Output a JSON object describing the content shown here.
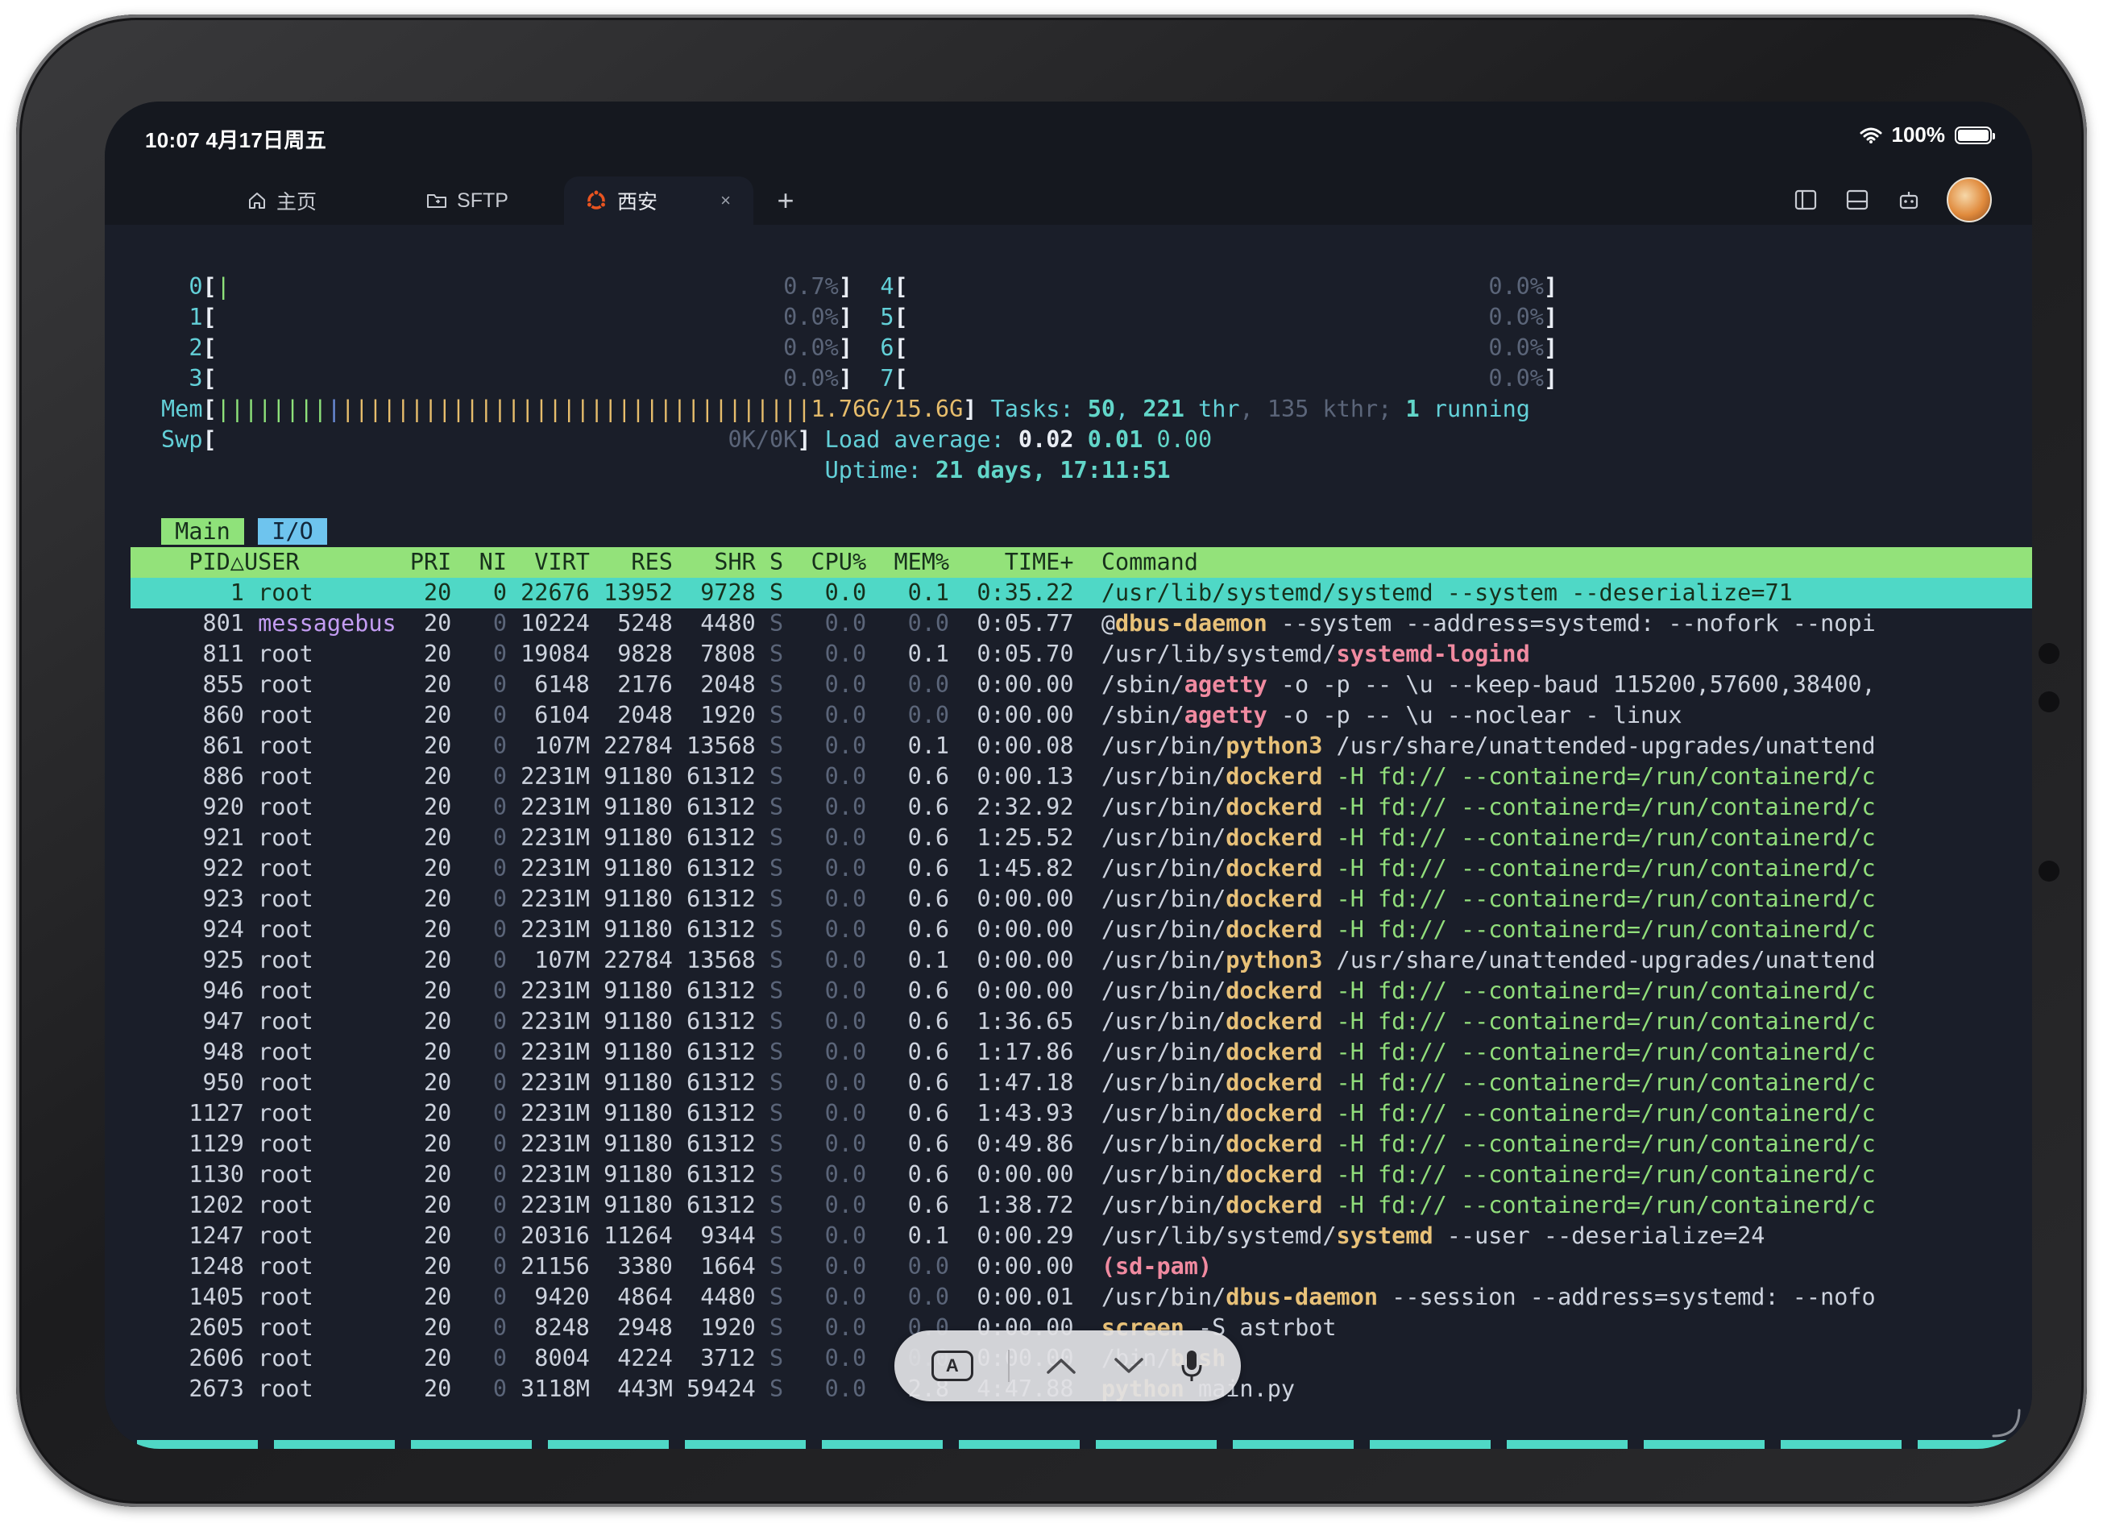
{
  "status": {
    "time": "10:07  4月17日周五",
    "battery": "100%"
  },
  "tabs": [
    {
      "label": "主页",
      "icon": "home-icon"
    },
    {
      "label": "SFTP",
      "icon": "folder-icon"
    },
    {
      "label": "西安",
      "icon": "ubuntu-icon",
      "close": "×"
    }
  ],
  "tab_add": "+",
  "colors": {
    "terminal_bg": "#1a1e29",
    "header_green": "#93e27a",
    "selected_teal": "#4fd8c6",
    "accent_yellow": "#e8c178"
  },
  "meters": {
    "cpus": [
      {
        "id": "0",
        "value": "0.7%"
      },
      {
        "id": "1",
        "value": "0.0%"
      },
      {
        "id": "2",
        "value": "0.0%"
      },
      {
        "id": "3",
        "value": "0.0%"
      },
      {
        "id": "4",
        "value": "0.0%"
      },
      {
        "id": "5",
        "value": "0.0%"
      },
      {
        "id": "6",
        "value": "0.0%"
      },
      {
        "id": "7",
        "value": "0.0%"
      }
    ],
    "mem_label": "Mem",
    "mem_value": "1.76G/15.6G",
    "swp_label": "Swp",
    "swp_value": "0K/0K",
    "tasks_label": "Tasks:",
    "tasks_count": "50",
    "threads": "221",
    "thr_label": "thr",
    "kthreads": "135",
    "kthr_label": "kthr;",
    "running": "1",
    "running_label": "running",
    "load_label": "Load average:",
    "load1": "0.02",
    "load5": "0.01",
    "load15": "0.00",
    "uptime_label": "Uptime:",
    "uptime": "21 days, 17:11:51"
  },
  "view_tabs": [
    "Main",
    "I/O"
  ],
  "columns": [
    "PID△",
    "USER",
    "PRI",
    "NI",
    "VIRT",
    "RES",
    "SHR",
    "S",
    "CPU%",
    "MEM%",
    "TIME+",
    "Command"
  ],
  "processes": [
    {
      "pid": "1",
      "user": "root",
      "pri": "20",
      "ni": "0",
      "virt": "22676",
      "res": "13952",
      "shr": "9728",
      "s": "S",
      "cpu": "0.0",
      "mem": "0.1",
      "time": "0:35.22",
      "cmd_pre": "/usr/lib/systemd/systemd",
      "cmd_name": "",
      "cmd_args": " --system --deserialize=71"
    },
    {
      "pid": "801",
      "user": "messagebus",
      "pri": "20",
      "ni": "0",
      "virt": "10224",
      "res": "5248",
      "shr": "4480",
      "s": "S",
      "cpu": "0.0",
      "mem": "0.0",
      "time": "0:05.77",
      "cmd_pre": "@",
      "cmd_name": "dbus-daemon",
      "cmd_args": " --system --address=systemd: --nofork --nopi"
    },
    {
      "pid": "811",
      "user": "root",
      "pri": "20",
      "ni": "0",
      "virt": "19084",
      "res": "9828",
      "shr": "7808",
      "s": "S",
      "cpu": "0.0",
      "mem": "0.1",
      "time": "0:05.70",
      "cmd_pre": "/usr/lib/systemd/",
      "cmd_name": "systemd-logind",
      "cmd_args": ""
    },
    {
      "pid": "855",
      "user": "root",
      "pri": "20",
      "ni": "0",
      "virt": "6148",
      "res": "2176",
      "shr": "2048",
      "s": "S",
      "cpu": "0.0",
      "mem": "0.0",
      "time": "0:00.00",
      "cmd_pre": "/sbin/",
      "cmd_name": "agetty",
      "cmd_args": " -o -p -- \\u --keep-baud 115200,57600,38400,"
    },
    {
      "pid": "860",
      "user": "root",
      "pri": "20",
      "ni": "0",
      "virt": "6104",
      "res": "2048",
      "shr": "1920",
      "s": "S",
      "cpu": "0.0",
      "mem": "0.0",
      "time": "0:00.00",
      "cmd_pre": "/sbin/",
      "cmd_name": "agetty",
      "cmd_args": " -o -p -- \\u --noclear - linux"
    },
    {
      "pid": "861",
      "user": "root",
      "pri": "20",
      "ni": "0",
      "virt": "107M",
      "res": "22784",
      "shr": "13568",
      "s": "S",
      "cpu": "0.0",
      "mem": "0.1",
      "time": "0:00.08",
      "cmd_pre": "/usr/bin/",
      "cmd_name": "python3",
      "cmd_args": " /usr/share/unattended-upgrades/unattend"
    },
    {
      "pid": "886",
      "user": "root",
      "pri": "20",
      "ni": "0",
      "virt": "2231M",
      "res": "91180",
      "shr": "61312",
      "s": "S",
      "cpu": "0.0",
      "mem": "0.6",
      "time": "0:00.13",
      "cmd_pre": "/usr/bin/",
      "cmd_name": "dockerd",
      "cmd_args": " -H fd:// --containerd=/run/containerd/c"
    },
    {
      "pid": "920",
      "user": "root",
      "pri": "20",
      "ni": "0",
      "virt": "2231M",
      "res": "91180",
      "shr": "61312",
      "s": "S",
      "cpu": "0.0",
      "mem": "0.6",
      "time": "2:32.92",
      "cmd_pre": "/usr/bin/",
      "cmd_name": "dockerd",
      "cmd_args": " -H fd:// --containerd=/run/containerd/c"
    },
    {
      "pid": "921",
      "user": "root",
      "pri": "20",
      "ni": "0",
      "virt": "2231M",
      "res": "91180",
      "shr": "61312",
      "s": "S",
      "cpu": "0.0",
      "mem": "0.6",
      "time": "1:25.52",
      "cmd_pre": "/usr/bin/",
      "cmd_name": "dockerd",
      "cmd_args": " -H fd:// --containerd=/run/containerd/c"
    },
    {
      "pid": "922",
      "user": "root",
      "pri": "20",
      "ni": "0",
      "virt": "2231M",
      "res": "91180",
      "shr": "61312",
      "s": "S",
      "cpu": "0.0",
      "mem": "0.6",
      "time": "1:45.82",
      "cmd_pre": "/usr/bin/",
      "cmd_name": "dockerd",
      "cmd_args": " -H fd:// --containerd=/run/containerd/c"
    },
    {
      "pid": "923",
      "user": "root",
      "pri": "20",
      "ni": "0",
      "virt": "2231M",
      "res": "91180",
      "shr": "61312",
      "s": "S",
      "cpu": "0.0",
      "mem": "0.6",
      "time": "0:00.00",
      "cmd_pre": "/usr/bin/",
      "cmd_name": "dockerd",
      "cmd_args": " -H fd:// --containerd=/run/containerd/c"
    },
    {
      "pid": "924",
      "user": "root",
      "pri": "20",
      "ni": "0",
      "virt": "2231M",
      "res": "91180",
      "shr": "61312",
      "s": "S",
      "cpu": "0.0",
      "mem": "0.6",
      "time": "0:00.00",
      "cmd_pre": "/usr/bin/",
      "cmd_name": "dockerd",
      "cmd_args": " -H fd:// --containerd=/run/containerd/c"
    },
    {
      "pid": "925",
      "user": "root",
      "pri": "20",
      "ni": "0",
      "virt": "107M",
      "res": "22784",
      "shr": "13568",
      "s": "S",
      "cpu": "0.0",
      "mem": "0.1",
      "time": "0:00.00",
      "cmd_pre": "/usr/bin/",
      "cmd_name": "python3",
      "cmd_args": " /usr/share/unattended-upgrades/unattend"
    },
    {
      "pid": "946",
      "user": "root",
      "pri": "20",
      "ni": "0",
      "virt": "2231M",
      "res": "91180",
      "shr": "61312",
      "s": "S",
      "cpu": "0.0",
      "mem": "0.6",
      "time": "0:00.00",
      "cmd_pre": "/usr/bin/",
      "cmd_name": "dockerd",
      "cmd_args": " -H fd:// --containerd=/run/containerd/c"
    },
    {
      "pid": "947",
      "user": "root",
      "pri": "20",
      "ni": "0",
      "virt": "2231M",
      "res": "91180",
      "shr": "61312",
      "s": "S",
      "cpu": "0.0",
      "mem": "0.6",
      "time": "1:36.65",
      "cmd_pre": "/usr/bin/",
      "cmd_name": "dockerd",
      "cmd_args": " -H fd:// --containerd=/run/containerd/c"
    },
    {
      "pid": "948",
      "user": "root",
      "pri": "20",
      "ni": "0",
      "virt": "2231M",
      "res": "91180",
      "shr": "61312",
      "s": "S",
      "cpu": "0.0",
      "mem": "0.6",
      "time": "1:17.86",
      "cmd_pre": "/usr/bin/",
      "cmd_name": "dockerd",
      "cmd_args": " -H fd:// --containerd=/run/containerd/c"
    },
    {
      "pid": "950",
      "user": "root",
      "pri": "20",
      "ni": "0",
      "virt": "2231M",
      "res": "91180",
      "shr": "61312",
      "s": "S",
      "cpu": "0.0",
      "mem": "0.6",
      "time": "1:47.18",
      "cmd_pre": "/usr/bin/",
      "cmd_name": "dockerd",
      "cmd_args": " -H fd:// --containerd=/run/containerd/c"
    },
    {
      "pid": "1127",
      "user": "root",
      "pri": "20",
      "ni": "0",
      "virt": "2231M",
      "res": "91180",
      "shr": "61312",
      "s": "S",
      "cpu": "0.0",
      "mem": "0.6",
      "time": "1:43.93",
      "cmd_pre": "/usr/bin/",
      "cmd_name": "dockerd",
      "cmd_args": " -H fd:// --containerd=/run/containerd/c"
    },
    {
      "pid": "1129",
      "user": "root",
      "pri": "20",
      "ni": "0",
      "virt": "2231M",
      "res": "91180",
      "shr": "61312",
      "s": "S",
      "cpu": "0.0",
      "mem": "0.6",
      "time": "0:49.86",
      "cmd_pre": "/usr/bin/",
      "cmd_name": "dockerd",
      "cmd_args": " -H fd:// --containerd=/run/containerd/c"
    },
    {
      "pid": "1130",
      "user": "root",
      "pri": "20",
      "ni": "0",
      "virt": "2231M",
      "res": "91180",
      "shr": "61312",
      "s": "S",
      "cpu": "0.0",
      "mem": "0.6",
      "time": "0:00.00",
      "cmd_pre": "/usr/bin/",
      "cmd_name": "dockerd",
      "cmd_args": " -H fd:// --containerd=/run/containerd/c"
    },
    {
      "pid": "1202",
      "user": "root",
      "pri": "20",
      "ni": "0",
      "virt": "2231M",
      "res": "91180",
      "shr": "61312",
      "s": "S",
      "cpu": "0.0",
      "mem": "0.6",
      "time": "1:38.72",
      "cmd_pre": "/usr/bin/",
      "cmd_name": "dockerd",
      "cmd_args": " -H fd:// --containerd=/run/containerd/c"
    },
    {
      "pid": "1247",
      "user": "root",
      "pri": "20",
      "ni": "0",
      "virt": "20316",
      "res": "11264",
      "shr": "9344",
      "s": "S",
      "cpu": "0.0",
      "mem": "0.1",
      "time": "0:00.29",
      "cmd_pre": "/usr/lib/systemd/",
      "cmd_name": "systemd",
      "cmd_args": " --user --deserialize=24"
    },
    {
      "pid": "1248",
      "user": "root",
      "pri": "20",
      "ni": "0",
      "virt": "21156",
      "res": "3380",
      "shr": "1664",
      "s": "S",
      "cpu": "0.0",
      "mem": "0.0",
      "time": "0:00.00",
      "cmd_pre": "",
      "cmd_name": "(sd-pam)",
      "cmd_args": ""
    },
    {
      "pid": "1405",
      "user": "root",
      "pri": "20",
      "ni": "0",
      "virt": "9420",
      "res": "4864",
      "shr": "4480",
      "s": "S",
      "cpu": "0.0",
      "mem": "0.0",
      "time": "0:00.01",
      "cmd_pre": "/usr/bin/",
      "cmd_name": "dbus-daemon",
      "cmd_args": " --session --address=systemd: --nofo"
    },
    {
      "pid": "2605",
      "user": "root",
      "pri": "20",
      "ni": "0",
      "virt": "8248",
      "res": "2948",
      "shr": "1920",
      "s": "S",
      "cpu": "0.0",
      "mem": "0.0",
      "time": "0:00.00",
      "cmd_pre": "",
      "cmd_name": "screen",
      "cmd_args": " -S astrbot"
    },
    {
      "pid": "2606",
      "user": "root",
      "pri": "20",
      "ni": "0",
      "virt": "8004",
      "res": "4224",
      "shr": "3712",
      "s": "S",
      "cpu": "0.0",
      "mem": "0.0",
      "time": "0:00.00",
      "cmd_pre": "/bin/",
      "cmd_name": "bash",
      "cmd_args": ""
    },
    {
      "pid": "2673",
      "user": "root",
      "pri": "20",
      "ni": "0",
      "virt": "3118M",
      "res": "443M",
      "shr": "59424",
      "s": "S",
      "cpu": "0.0",
      "mem": "2.8",
      "time": "4:47.88",
      "cmd_pre": "",
      "cmd_name": "python",
      "cmd_args": " main.py"
    }
  ],
  "keyboard_bar": {
    "key_a": "A"
  }
}
